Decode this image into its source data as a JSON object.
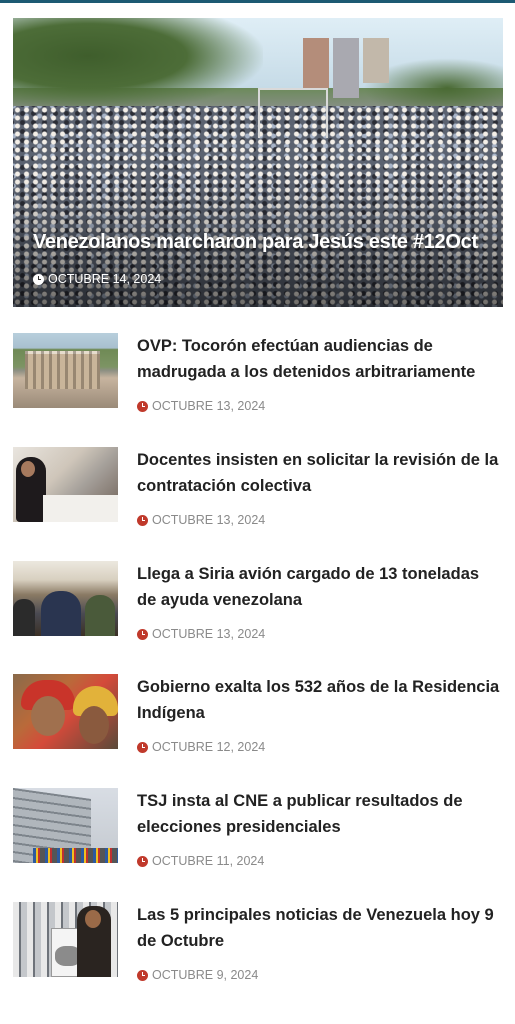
{
  "hero": {
    "title": "Venezolanos marcharon para Jesús este #12Oct",
    "date": "OCTUBRE 14, 2024",
    "icon": "clock-icon"
  },
  "articles": [
    {
      "title": "OVP: Tocorón efectúan audiencias de madrugada a los detenidos arbitrariamente",
      "date": "OCTUBRE 13, 2024"
    },
    {
      "title": "Docentes insisten en solicitar la revisión de la contratación colectiva",
      "date": "OCTUBRE 13, 2024"
    },
    {
      "title": "Llega a Siria avión cargado de 13 toneladas de ayuda venezolana",
      "date": "OCTUBRE 13, 2024"
    },
    {
      "title": "Gobierno exalta los 532 años de la Residencia Indígena",
      "date": "OCTUBRE 12, 2024"
    },
    {
      "title": "TSJ insta al CNE a publicar resultados de elecciones presidenciales",
      "date": "OCTUBRE 11, 2024"
    },
    {
      "title": "Las 5 principales noticias de Venezuela hoy 9 de Octubre",
      "date": "OCTUBRE 9, 2024"
    }
  ],
  "colors": {
    "accent_bar": "#1d5a73",
    "date_icon": "#c0392b",
    "title_text": "#222222",
    "date_text": "#8a8a8a"
  }
}
